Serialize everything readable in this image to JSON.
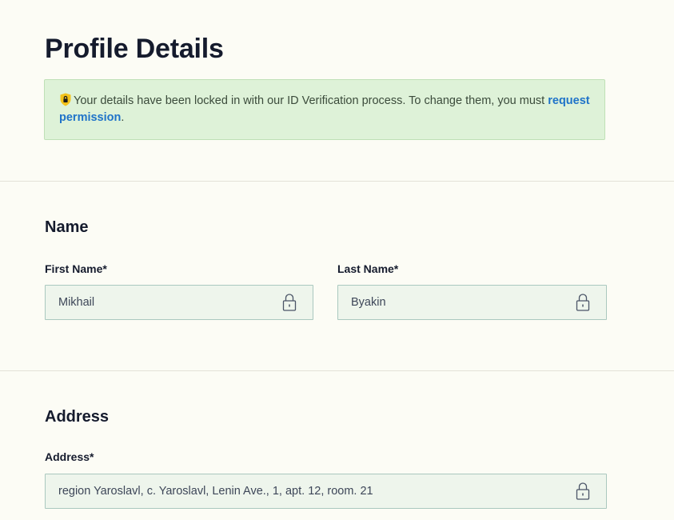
{
  "page": {
    "title": "Profile Details"
  },
  "notice": {
    "text_before": "Your details have been locked in with our ID Verification process. To change them, you must ",
    "link_text": "request permission",
    "text_after": ".",
    "icon": "shield-icon"
  },
  "name_section": {
    "heading": "Name",
    "first_name": {
      "label": "First Name*",
      "value": "Mikhail",
      "icon": "lock-icon"
    },
    "last_name": {
      "label": "Last Name*",
      "value": "Byakin",
      "icon": "lock-icon"
    }
  },
  "address_section": {
    "heading": "Address",
    "address": {
      "label": "Address*",
      "value": "region Yaroslavl, c. Yaroslavl, Lenin Ave., 1, apt. 12, room. 21",
      "icon": "lock-icon"
    }
  },
  "colors": {
    "page_background": "#fcfcf5",
    "notice_background": "#def2d8",
    "notice_border": "#bfe0b6",
    "link": "#1f73c9",
    "field_background": "#eef5ec",
    "field_border": "#aac8bf",
    "heading_text": "#151b2d"
  }
}
